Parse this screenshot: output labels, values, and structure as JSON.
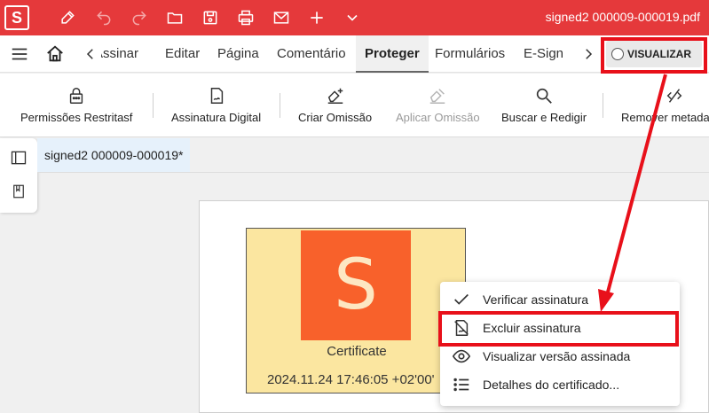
{
  "app": {
    "logo_letter": "S",
    "filename": "signed2 000009-000019.pdf"
  },
  "menu": {
    "items": [
      "Assinar",
      "Editar",
      "Página",
      "Comentário",
      "Proteger",
      "Formulários",
      "E-Sign"
    ],
    "active": "Proteger",
    "view_button": "VISUALIZAR"
  },
  "toolbar": {
    "tools": [
      {
        "label": "Permissões Restritasf",
        "icon": "lock-icon"
      },
      {
        "label": "Assinatura Digital",
        "icon": "document-signature-icon"
      },
      {
        "label": "Criar Omissão",
        "icon": "eraser-plus-icon"
      },
      {
        "label": "Aplicar Omissão",
        "icon": "eraser-icon",
        "disabled": true
      },
      {
        "label": "Buscar e Redigir",
        "icon": "search-icon"
      },
      {
        "label": "Remover metadados",
        "icon": "remove-metadata-icon"
      }
    ]
  },
  "document": {
    "tab_title": "signed2 000009-000019*",
    "certificate": {
      "letter": "S",
      "title": "Certificate",
      "date": "2024.11.24 17:46:05 +02'00'"
    }
  },
  "context_menu": {
    "items": [
      {
        "label": "Verificar assinatura",
        "icon": "check-icon"
      },
      {
        "label": "Excluir assinatura",
        "icon": "delete-signature-icon"
      },
      {
        "label": "Visualizar versão assinada",
        "icon": "eye-icon"
      },
      {
        "label": "Detalhes do certificado...",
        "icon": "list-icon"
      }
    ]
  },
  "colors": {
    "brand": "#e5393b",
    "highlight": "#e8101a",
    "cert_bg": "#fbe6a0",
    "cert_logo": "#f8612b"
  }
}
